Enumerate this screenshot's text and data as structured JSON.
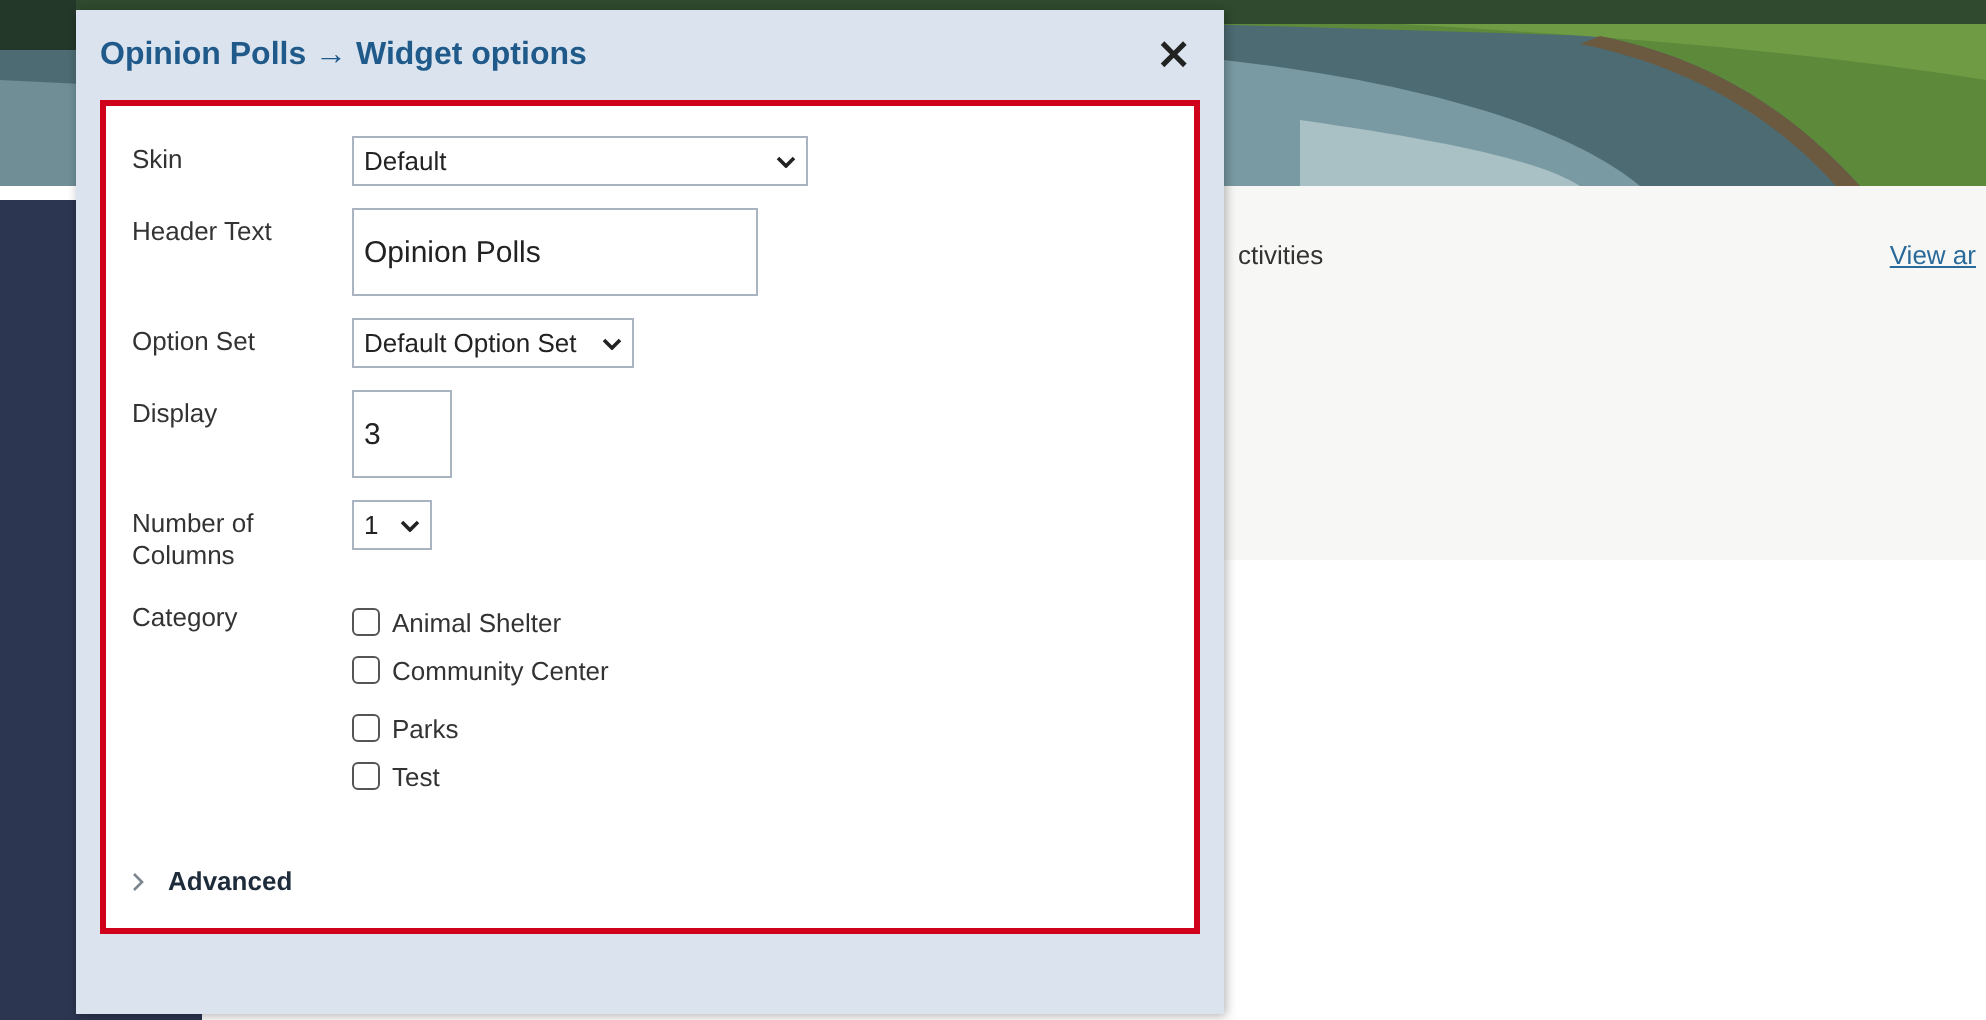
{
  "background": {
    "text": "ctivities",
    "link": "View ar"
  },
  "dialog": {
    "title": "Opinion Polls → Widget options",
    "close": "×",
    "fields": [
      {
        "kind": "select",
        "label": "Skin",
        "value": "Default"
      },
      {
        "kind": "text",
        "label": "Header Text",
        "value": "Opinion Polls"
      },
      {
        "kind": "select",
        "label": "Option Set",
        "value": "Default Option Set"
      },
      {
        "kind": "text",
        "label": "Display",
        "value": "3"
      },
      {
        "kind": "select",
        "label": "Number of Columns",
        "value": "1"
      },
      {
        "kind": "checklist",
        "label": "Category",
        "options": [
          {
            "label": "Animal Shelter",
            "checked": false
          },
          {
            "label": "Community Center",
            "checked": false
          },
          {
            "label": "Parks",
            "checked": false
          },
          {
            "label": "Test",
            "checked": false
          }
        ]
      }
    ],
    "advanced": {
      "label": "Advanced",
      "expanded": false
    }
  }
}
